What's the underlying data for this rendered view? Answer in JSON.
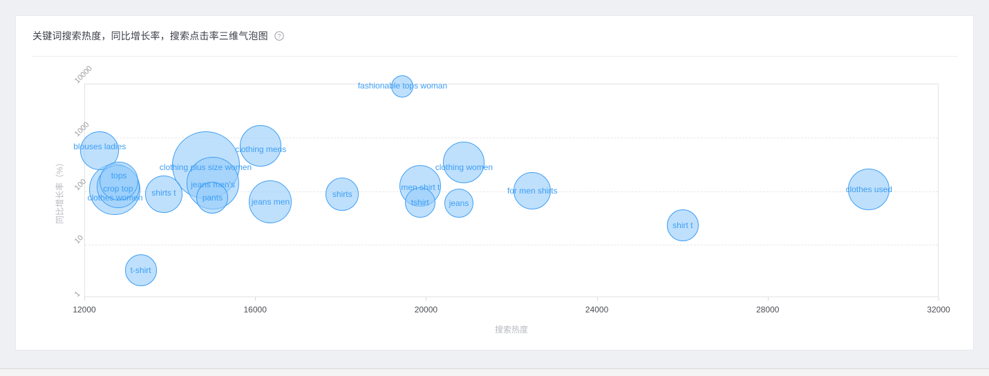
{
  "card": {
    "title": "关键词搜索热度，同比增长率，搜索点击率三维气泡图",
    "help_icon": "question-circle-icon"
  },
  "colors": {
    "bubble_fill": "#97cdfa",
    "bubble_stroke": "#3d9ef4",
    "label_text": "#3d9ef4",
    "axis_text": "#4b4d53",
    "axis_title": "#b9bbc0",
    "grid": "#e6e6e8",
    "card_bg": "#ffffff",
    "page_bg": "#eff0f4"
  },
  "chart_data": {
    "type": "scatter",
    "title": "关键词搜索热度，同比增长率，搜索点击率三维气泡图",
    "xlabel": "搜索热度",
    "ylabel": "同比增长率（%）",
    "xlim": [
      12000,
      32000
    ],
    "ylim": [
      1,
      10000
    ],
    "yscale": "log",
    "xticks": [
      "12000",
      "16000",
      "20000",
      "24000",
      "28000",
      "32000"
    ],
    "yticks": [
      "1",
      "10",
      "100",
      "1000",
      "10000"
    ],
    "grid": true,
    "legend": "none",
    "size_metric": "搜索点击率",
    "points": [
      {
        "label": "blouses ladies",
        "x": 12360,
        "y": 560,
        "r": 28,
        "label_dx": 0,
        "label_dy": -6
      },
      {
        "label": "clothes women",
        "x": 12720,
        "y": 105,
        "r": 37,
        "label_dx": 0,
        "label_dy": 12
      },
      {
        "label": "crop top",
        "x": 12790,
        "y": 118,
        "r": 31,
        "label_dx": 0,
        "label_dy": 3
      },
      {
        "label": "tops",
        "x": 12810,
        "y": 148,
        "r": 28,
        "label_dx": 0,
        "label_dy": -8
      },
      {
        "label": "t-shirt",
        "x": 13320,
        "y": 3.2,
        "r": 23,
        "label_dx": 0,
        "label_dy": 0
      },
      {
        "label": "shirts t",
        "x": 13860,
        "y": 85,
        "r": 27,
        "label_dx": 0,
        "label_dy": -2
      },
      {
        "label": "clothing plus size women",
        "x": 14840,
        "y": 300,
        "r": 49,
        "label_dx": 0,
        "label_dy": 3
      },
      {
        "label": "jeans men's",
        "x": 15010,
        "y": 135,
        "r": 38,
        "label_dx": 0,
        "label_dy": 2
      },
      {
        "label": "pants",
        "x": 15000,
        "y": 74,
        "r": 23,
        "label_dx": 0,
        "label_dy": 0
      },
      {
        "label": "clothing mens",
        "x": 16130,
        "y": 680,
        "r": 30,
        "label_dx": 0,
        "label_dy": 5
      },
      {
        "label": "jeans men",
        "x": 16360,
        "y": 62,
        "r": 31,
        "label_dx": 0,
        "label_dy": 0
      },
      {
        "label": "shirts",
        "x": 18040,
        "y": 85,
        "r": 24,
        "label_dx": 0,
        "label_dy": 0
      },
      {
        "label": "fashionable tops woman",
        "x": 19450,
        "y": 9000,
        "r": 16,
        "label_dx": 0,
        "label_dy": -1
      },
      {
        "label": "men shirt t",
        "x": 19870,
        "y": 120,
        "r": 30,
        "label_dx": 0,
        "label_dy": 2
      },
      {
        "label": "tshirt",
        "x": 19860,
        "y": 60,
        "r": 22,
        "label_dx": 0,
        "label_dy": 0
      },
      {
        "label": "jeans",
        "x": 20770,
        "y": 57,
        "r": 21,
        "label_dx": 0,
        "label_dy": 0
      },
      {
        "label": "clothing women",
        "x": 20890,
        "y": 330,
        "r": 30,
        "label_dx": 0,
        "label_dy": 7
      },
      {
        "label": "for men shirts",
        "x": 22490,
        "y": 98,
        "r": 27,
        "label_dx": 0,
        "label_dy": 0
      },
      {
        "label": "shirt t",
        "x": 26010,
        "y": 22,
        "r": 23,
        "label_dx": 0,
        "label_dy": 0
      },
      {
        "label": "clothes used",
        "x": 30370,
        "y": 105,
        "r": 30,
        "label_dx": 0,
        "label_dy": 0
      }
    ]
  }
}
